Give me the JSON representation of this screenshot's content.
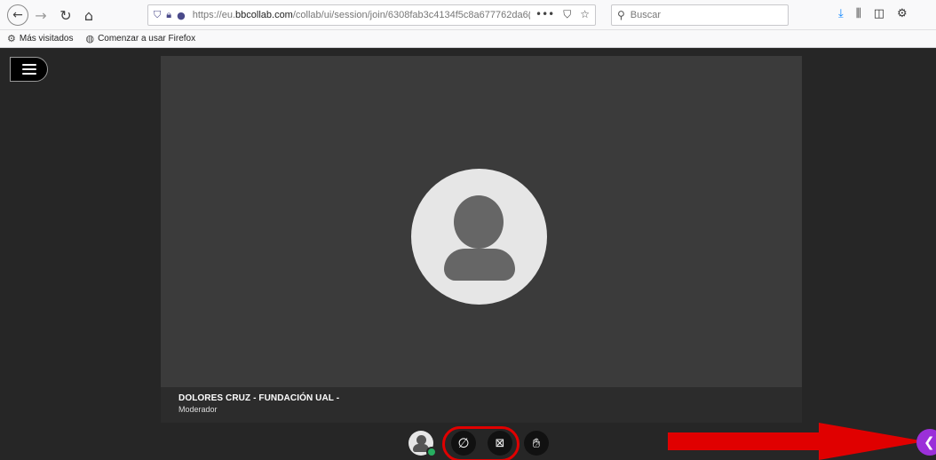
{
  "browser": {
    "url_prefix": "https://eu.",
    "url_domain": "bbcollab.com",
    "url_path": "/collab/ui/session/join/6308fab3c4134f5c8a677762da6(",
    "search_placeholder": "Buscar",
    "more_glyph": "•••",
    "bookmarks": [
      {
        "label": "Más visitados"
      },
      {
        "label": "Comenzar a usar Firefox"
      }
    ]
  },
  "session": {
    "participant_name": "DOLORES CRUZ - FUNDACIÓN UAL -",
    "participant_role": "Moderador"
  },
  "colors": {
    "panel_button": "#9b30d9",
    "annotation": "#e00000",
    "status_ok": "#27ae60"
  }
}
